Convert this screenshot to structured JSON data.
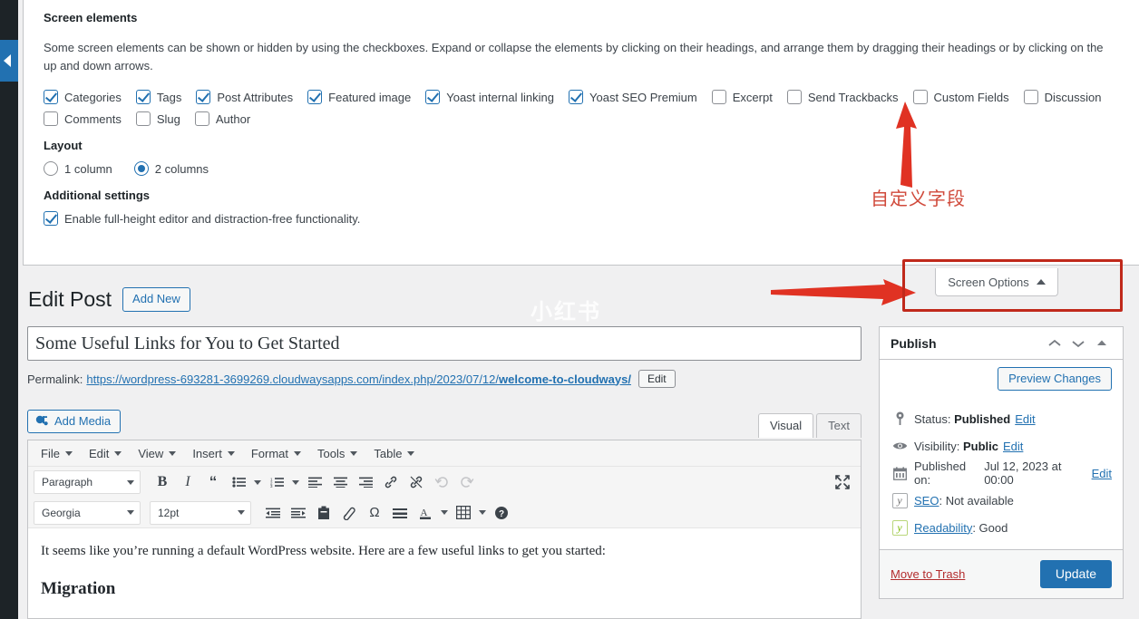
{
  "screen_options": {
    "heading": "Screen elements",
    "description": "Some screen elements can be shown or hidden by using the checkboxes. Expand or collapse the elements by clicking on their headings, and arrange them by dragging their headings or by clicking on the up and down arrows.",
    "checkboxes_row1": [
      {
        "label": "Categories",
        "checked": true
      },
      {
        "label": "Tags",
        "checked": true
      },
      {
        "label": "Post Attributes",
        "checked": true
      },
      {
        "label": "Featured image",
        "checked": true
      },
      {
        "label": "Yoast internal linking",
        "checked": true
      },
      {
        "label": "Yoast SEO Premium",
        "checked": true
      },
      {
        "label": "Excerpt",
        "checked": false
      },
      {
        "label": "Send Trackbacks",
        "checked": false
      },
      {
        "label": "Custom Fields",
        "checked": false
      },
      {
        "label": "Discussion",
        "checked": false
      }
    ],
    "checkboxes_row2": [
      {
        "label": "Comments",
        "checked": false
      },
      {
        "label": "Slug",
        "checked": false
      },
      {
        "label": "Author",
        "checked": false
      }
    ],
    "layout_heading": "Layout",
    "layout_options": [
      {
        "label": "1 column",
        "selected": false
      },
      {
        "label": "2 columns",
        "selected": true
      }
    ],
    "additional_heading": "Additional settings",
    "additional_option": {
      "label": "Enable full-height editor and distraction-free functionality.",
      "checked": true
    },
    "tab_label": "Screen Options"
  },
  "annotations": {
    "chinese_label": "自定义字段",
    "accent_color": "#c0291b",
    "text_color": "#d04a3b"
  },
  "watermark": "小红书",
  "page": {
    "title": "Edit Post",
    "add_new_label": "Add New"
  },
  "post": {
    "title_value": "Some Useful Links for You to Get Started",
    "permalink_label": "Permalink:",
    "permalink_prefix": "https://wordpress-693281-3699269.cloudwaysapps.com/index.php/2023/07/12/",
    "permalink_slug": "welcome-to-cloudways/",
    "permalink_edit_label": "Edit"
  },
  "editor": {
    "add_media_label": "Add Media",
    "tabs": [
      {
        "label": "Visual",
        "active": true
      },
      {
        "label": "Text",
        "active": false
      }
    ],
    "menubar": [
      "File",
      "Edit",
      "View",
      "Insert",
      "Format",
      "Tools",
      "Table"
    ],
    "paragraph_format": "Paragraph",
    "font_family": "Georgia",
    "font_size": "12pt",
    "content_paragraph": "It seems like you’re running a default WordPress website. Here are a few useful links to get you started:",
    "content_subheading": "Migration"
  },
  "publish": {
    "title": "Publish",
    "preview_label": "Preview Changes",
    "status_label": "Status:",
    "status_value": "Published",
    "status_edit": "Edit",
    "visibility_label": "Visibility:",
    "visibility_value": "Public",
    "visibility_edit": "Edit",
    "published_label": "Published on:",
    "published_value": "Jul 12, 2023 at 00:00",
    "published_edit": "Edit",
    "seo_label": "SEO",
    "seo_value": ": Not available",
    "readability_label": "Readability",
    "readability_value": ": Good",
    "trash_label": "Move to Trash",
    "update_label": "Update"
  }
}
